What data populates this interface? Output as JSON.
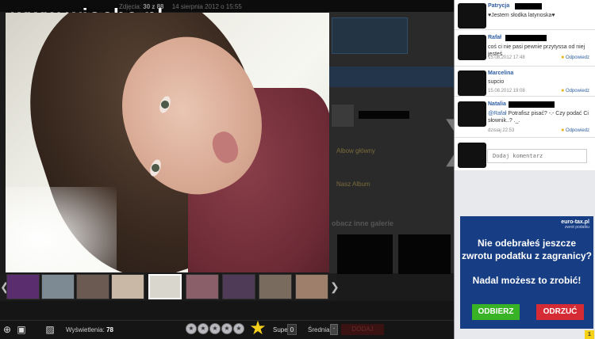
{
  "watermark": "www.wiocha.pl",
  "header": {
    "label": "Zdjęcia:",
    "counter": "30 z 88",
    "date": "14 sierpnia 2012 o 15:55"
  },
  "background": {
    "gallery_title": "obacz inne galerie",
    "row1": "Albow główny",
    "row2": "Nasz Album",
    "red_button": "DODAJ"
  },
  "toolbar": {
    "views_label": "Wyświetlenia:",
    "views_value": "78",
    "super_label": "Super",
    "super_count": "0",
    "average_label": "Średnia:",
    "average_value": "-"
  },
  "comments": [
    {
      "name": "Patrycja",
      "text": "♥Jestem słodka latynoska♥",
      "date": "",
      "reply": ""
    },
    {
      "name": "Rafał",
      "text": "coś ci nie pasi pewnie przytyssa od niej jesteś",
      "date": "15.08.2012 17:48",
      "reply": "Odpowiedz"
    },
    {
      "name": "Marcelina",
      "text": "supcio",
      "date": "15.08.2012 19:08",
      "reply": "Odpowiedz"
    },
    {
      "name": "Natalia",
      "mention": "@Rafał",
      "text": " Potrafisz pisać? -.- Czy podać Ci słownik..? ._.",
      "date": "dzisiaj 22:53",
      "reply": "Odpowiedz"
    }
  ],
  "add_comment_placeholder": "Dodaj komentarz",
  "ad": {
    "logo": "euro-tax.pl",
    "logo_sub": "zwrot podatku",
    "line1": "Nie odebrałeś jeszcze",
    "line2": "zwrotu podatku z zagranicy?",
    "line3": "Nadal możesz to zrobić!",
    "yes_button": "ODBIERZ",
    "no_button": "ODRZUĆ"
  },
  "badge": "1",
  "icons": {
    "zoom": "zoom-icon",
    "fullscreen": "fullscreen-icon",
    "add_photo": "add-photo-icon",
    "prev": "chevron-left-icon",
    "next": "chevron-right-icon",
    "rating_star": "star-icon"
  },
  "colors": {
    "link_blue": "#2f5fa5",
    "ad_blue": "#173e84",
    "ad_green": "#38b325",
    "ad_red": "#d52b34",
    "star_gold": "#f3cf1a"
  }
}
